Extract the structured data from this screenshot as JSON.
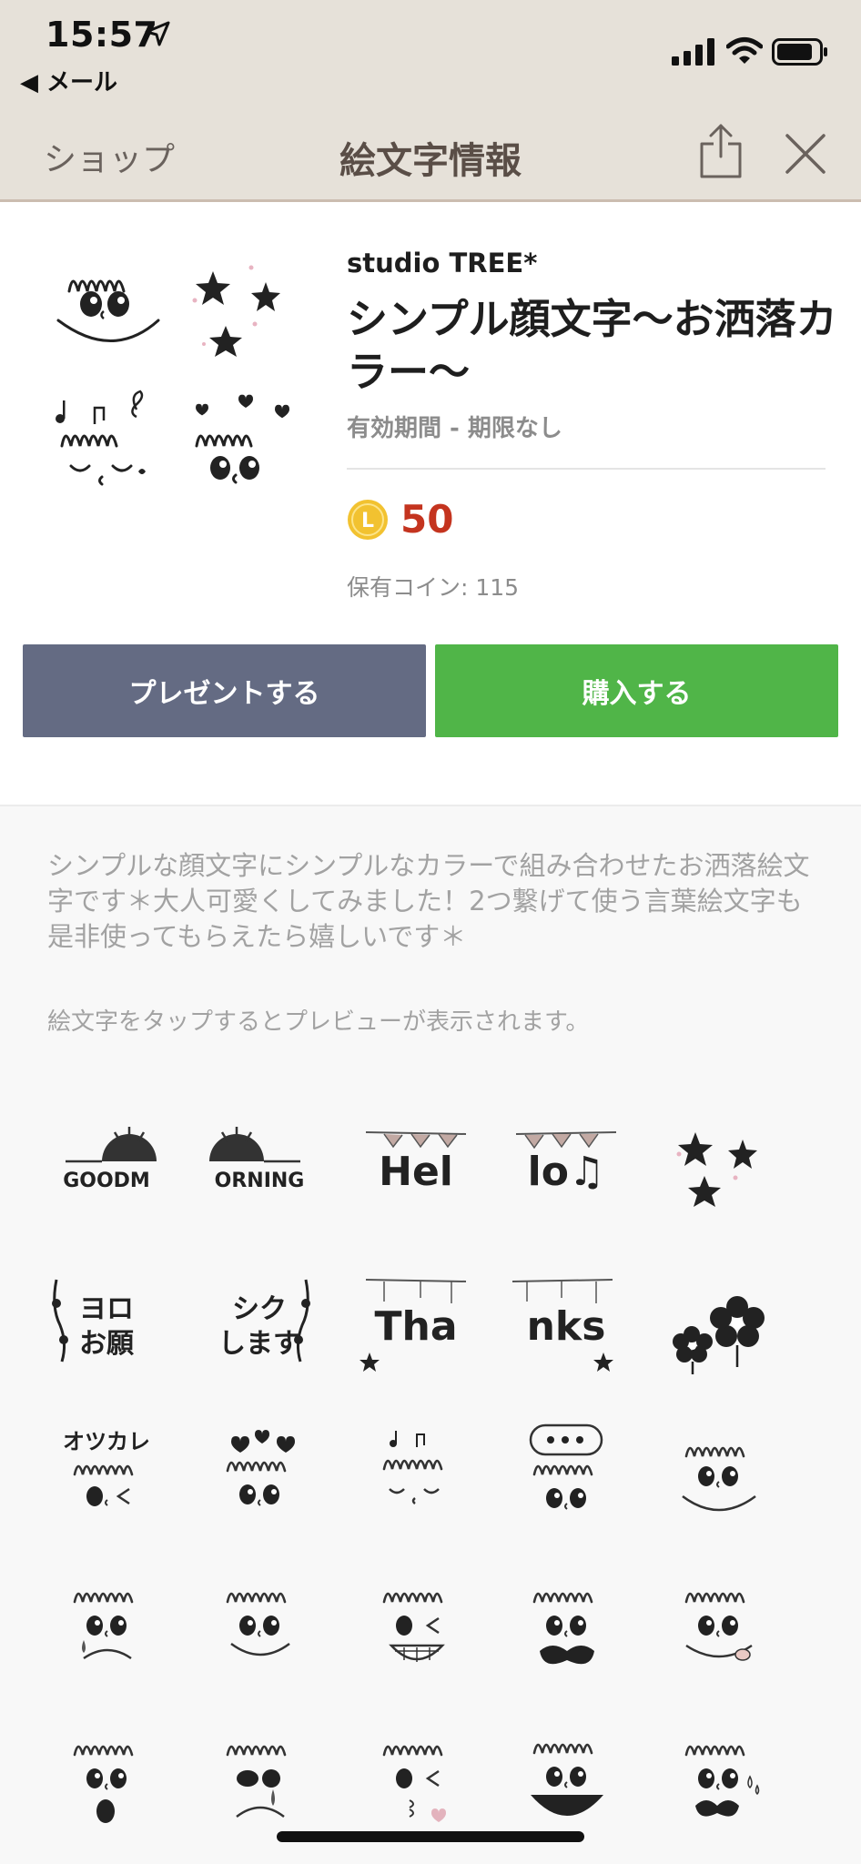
{
  "status_bar": {
    "time": "15:57",
    "back_app": "◀ メール"
  },
  "nav": {
    "back_label": "ショップ",
    "title": "絵文字情報"
  },
  "product": {
    "publisher": "studio TREE*",
    "title": "シンプル顔文字〜お洒落カラー〜",
    "validity": "有効期間 - 期限なし",
    "coin_letter": "L",
    "price": "50",
    "owned_coins": "保有コイン: 115"
  },
  "buttons": {
    "gift_label": "プレゼントする",
    "buy_label": "購入する"
  },
  "description": {
    "text": "シンプルな顔文字にシンプルなカラーで組み合わせたお洒落絵文字です＊大人可愛くしてみました！2つ繋げて使う言葉絵文字も是非使ってもらえたら嬉しいです＊",
    "hint": "絵文字をタップするとプレビューが表示されます。"
  },
  "emoji_grid": [
    {
      "name": "good-morning-left",
      "text": "GOODM"
    },
    {
      "name": "good-morning-right",
      "text": "ORNING"
    },
    {
      "name": "hello-left",
      "text": "Hel"
    },
    {
      "name": "hello-right",
      "text": "lo♫"
    },
    {
      "name": "stars",
      "text": ""
    },
    {
      "name": "yoroshiku-left",
      "text": "ヨロ\nお願"
    },
    {
      "name": "yoroshiku-right",
      "text": "シク\nします"
    },
    {
      "name": "thanks-left",
      "text": "Tha"
    },
    {
      "name": "thanks-right",
      "text": "nks"
    },
    {
      "name": "flowers",
      "text": ""
    },
    {
      "name": "otsukare-face",
      "text": "オツカレ"
    },
    {
      "name": "hearts-face",
      "text": ""
    },
    {
      "name": "music-face",
      "text": ""
    },
    {
      "name": "speech-face",
      "text": ""
    },
    {
      "name": "smile-face",
      "text": ""
    },
    {
      "name": "sad-face",
      "text": ""
    },
    {
      "name": "grin-face",
      "text": ""
    },
    {
      "name": "wink-teeth-face",
      "text": ""
    },
    {
      "name": "mustache-face",
      "text": ""
    },
    {
      "name": "tongue-face",
      "text": ""
    },
    {
      "name": "surprised-face",
      "text": ""
    },
    {
      "name": "crying-face",
      "text": ""
    },
    {
      "name": "kiss-face",
      "text": ""
    },
    {
      "name": "big-smile-face",
      "text": ""
    },
    {
      "name": "sweat-mustache-face",
      "text": ""
    }
  ],
  "colors": {
    "header_bg": "#e6e1d9",
    "gift_button": "#646b83",
    "buy_button": "#50b548",
    "price": "#c4341f",
    "coin": "#f2c230"
  }
}
